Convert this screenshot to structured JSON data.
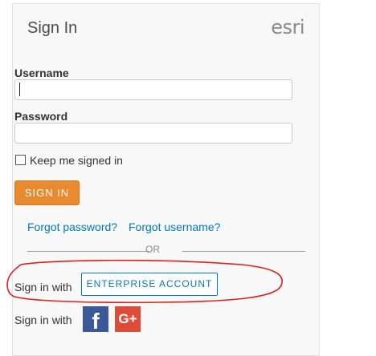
{
  "card": {
    "title": "Sign In",
    "logo_text": "esri"
  },
  "username": {
    "label": "Username",
    "value": ""
  },
  "password": {
    "label": "Password",
    "value": ""
  },
  "keep_signed_in": {
    "label": "Keep me signed in",
    "checked": false
  },
  "signin_button": {
    "label": "SIGN IN"
  },
  "links": {
    "forgot_password": "Forgot password?",
    "forgot_username": "Forgot username?"
  },
  "separator": {
    "text": "OR"
  },
  "enterprise": {
    "prefix": "Sign in with",
    "button_label": "ENTERPRISE ACCOUNT"
  },
  "social": {
    "prefix": "Sign in with",
    "facebook_glyph": "f",
    "google_glyph": "G+",
    "icons": [
      "facebook-icon",
      "google-plus-icon"
    ]
  },
  "colors": {
    "accent_orange": "#ea8a2e",
    "link_blue": "#0079c1",
    "facebook_blue": "#3b5998",
    "google_red": "#dd4b39",
    "annotation_red": "#e0201e"
  }
}
